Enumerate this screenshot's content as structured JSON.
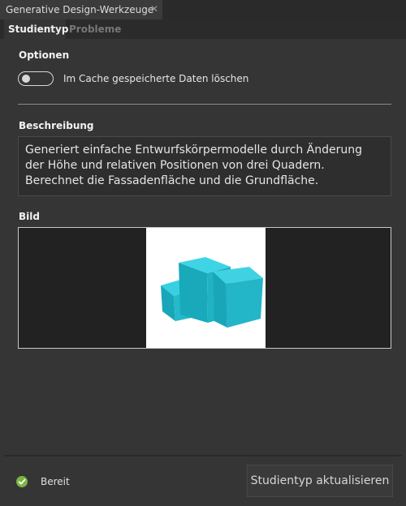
{
  "window": {
    "title": "Generative Design-Werkzeuge",
    "close_glyph": "✕"
  },
  "tabs": [
    {
      "label": "Studientyp",
      "active": true
    },
    {
      "label": "Probleme",
      "active": false
    }
  ],
  "options": {
    "heading": "Optionen",
    "clear_cache_toggle": {
      "label": "Im Cache gespeicherte Daten löschen",
      "on": false
    }
  },
  "description": {
    "heading": "Beschreibung",
    "text": "Generiert einfache Entwurfskörpermodelle durch Änderung der Höhe und relativen Positionen von drei Quadern. Berechnet die Fassadenfläche und die Grundfläche."
  },
  "image": {
    "heading": "Bild",
    "subject": "three-cuboids-massing-model",
    "color": "#1fb8cc"
  },
  "footer": {
    "status": "Bereit",
    "status_color": "#7cb342",
    "update_button": "Studientyp aktualisieren"
  }
}
